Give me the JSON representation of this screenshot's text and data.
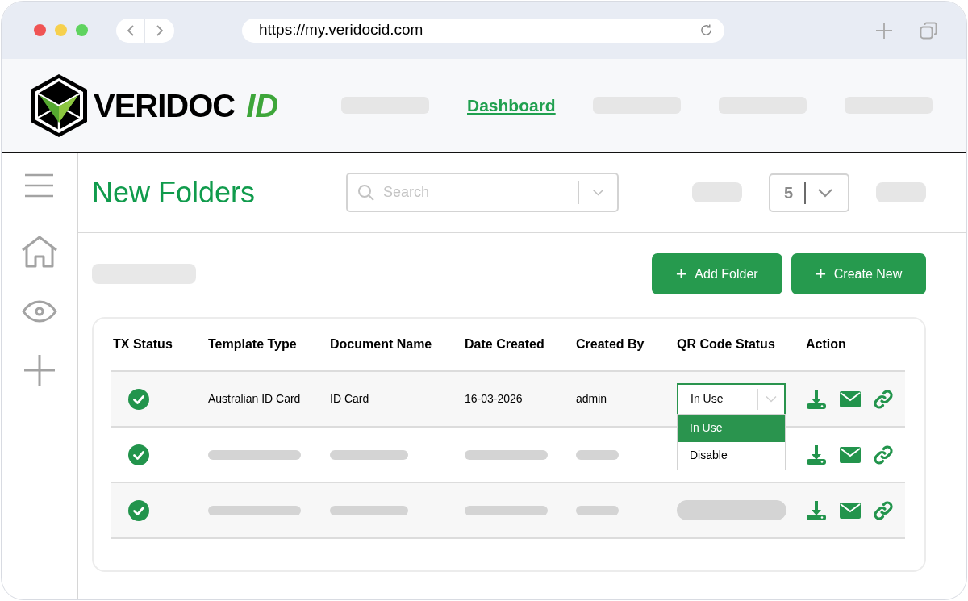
{
  "browser": {
    "url": "https://my.veridocid.com"
  },
  "header": {
    "logo": {
      "word": "VERIDOC",
      "accent": "ID"
    },
    "nav": [
      {
        "kind": "skeleton"
      },
      {
        "kind": "link",
        "label": "Dashboard",
        "selected": true
      },
      {
        "kind": "skeleton"
      },
      {
        "kind": "skeleton"
      },
      {
        "kind": "skeleton"
      }
    ]
  },
  "page": {
    "title": "New Folders",
    "search": {
      "placeholder": "Search"
    },
    "page_size": {
      "value": "5"
    },
    "buttons": [
      "Add Folder",
      "Create New"
    ]
  },
  "table": {
    "columns": [
      "TX Status",
      "Template Type",
      "Document Name",
      "Date Created",
      "Created By",
      "QR Code Status",
      "Action"
    ],
    "rows": [
      {
        "kind": "data",
        "cells": [
          "Australian ID Card",
          "ID Card",
          "16-03-2026",
          "admin"
        ],
        "qr_status": {
          "value": "In Use",
          "expanded": true,
          "options": [
            {
              "label": "In Use",
              "selected": true
            },
            {
              "label": "Disable",
              "selected": false
            }
          ]
        }
      },
      {
        "kind": "skeleton"
      },
      {
        "kind": "skeleton"
      }
    ]
  }
}
